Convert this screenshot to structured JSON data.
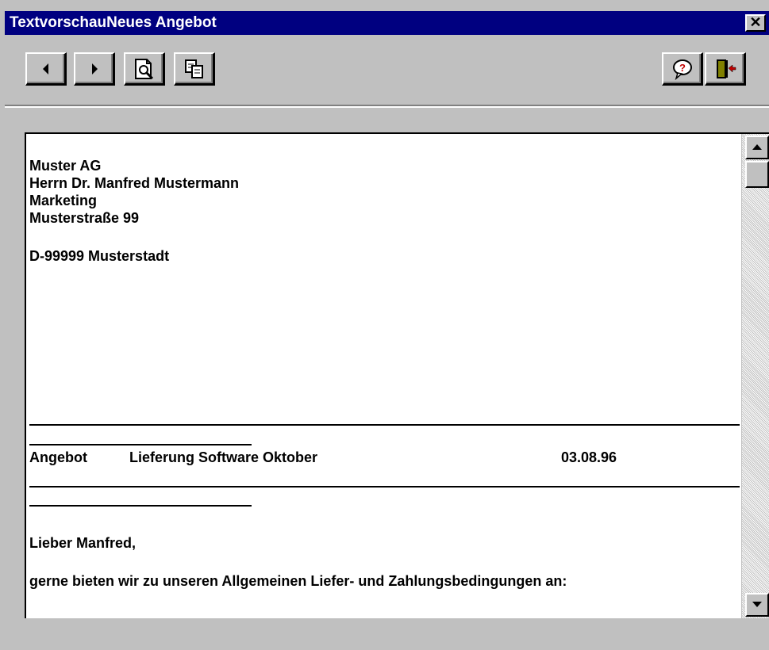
{
  "window": {
    "title": "TextvorschauNeues Angebot",
    "close_glyph": "✕"
  },
  "toolbar": {
    "buttons": [
      {
        "name": "previous-page",
        "icon": "arrow-left-icon"
      },
      {
        "name": "next-page",
        "icon": "arrow-right-icon"
      },
      {
        "name": "print-preview",
        "icon": "page-magnifier-icon"
      },
      {
        "name": "copy",
        "icon": "copy-icon"
      },
      {
        "name": "help",
        "icon": "help-bubble-icon"
      },
      {
        "name": "exit",
        "icon": "exit-door-icon"
      }
    ]
  },
  "document": {
    "address": {
      "company": "Muster AG",
      "recipient": "Herrn Dr. Manfred Mustermann",
      "department": "Marketing",
      "street": "Musterstraße 99",
      "city": "D-99999 Musterstadt"
    },
    "subject": {
      "type": "Angebot",
      "title": "Lieferung Software Oktober",
      "date": "03.08.96"
    },
    "salutation": "Lieber Manfred,",
    "body_line": "gerne bieten wir zu unseren Allgemeinen Liefer- und Zahlungsbedingungen an:"
  }
}
